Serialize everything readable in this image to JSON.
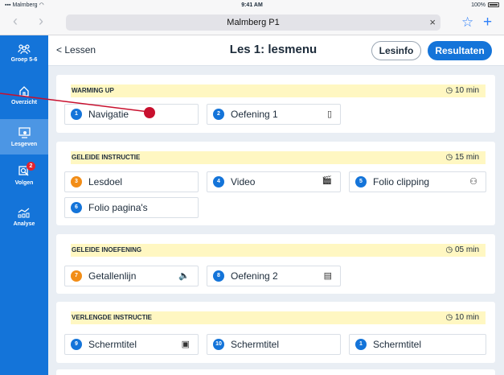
{
  "status": {
    "carrier": "Malmberg",
    "time": "9:41 AM",
    "battery": "100%"
  },
  "browser": {
    "url": "Malmberg P1",
    "clear": "×",
    "back_icon": "chevron-left-icon",
    "forward_icon": "chevron-right-icon",
    "bookmark_icon": "star-icon",
    "add_icon": "plus-icon"
  },
  "sidebar": {
    "items": [
      {
        "label": "Groep 5-6",
        "icon": "group-icon"
      },
      {
        "label": "Overzicht",
        "icon": "home-icon"
      },
      {
        "label": "Lesgeven",
        "icon": "teach-icon"
      },
      {
        "label": "Volgen",
        "icon": "search-person-icon",
        "badge": "2"
      },
      {
        "label": "Analyse",
        "icon": "chart-icon"
      }
    ]
  },
  "header": {
    "back": "< Lessen",
    "title": "Les 1: lesmenu",
    "lesinfo": "Lesinfo",
    "resultaten": "Resultaten"
  },
  "sections": [
    {
      "title": "WARMING UP",
      "time": "10 min",
      "items": [
        {
          "num": "1",
          "label": "Navigatie",
          "icon": ""
        },
        {
          "num": "2",
          "label": "Oefening 1",
          "icon": "tablet-icon"
        }
      ]
    },
    {
      "title": "GELEIDE INSTRUCTIE",
      "time": "15 min",
      "items": [
        {
          "num": "3",
          "label": "Lesdoel",
          "icon": ""
        },
        {
          "num": "4",
          "label": "Video",
          "icon": "clapperboard-icon"
        },
        {
          "num": "5",
          "label": "Folio clipping",
          "icon": "people-icon"
        },
        {
          "num": "6",
          "label": "Folio pagina's",
          "icon": ""
        }
      ]
    },
    {
      "title": "GELEIDE INOEFENING",
      "time": "05 min",
      "items": [
        {
          "num": "7",
          "label": "Getallenlijn",
          "icon": "speaker-icon"
        },
        {
          "num": "8",
          "label": "Oefening 2",
          "icon": "document-icon"
        }
      ]
    },
    {
      "title": "VERLENGDE INSTRUCTIE",
      "time": "10 min",
      "items": [
        {
          "num": "9",
          "label": "Schermtitel",
          "icon": "briefcase-icon"
        },
        {
          "num": "10",
          "label": "Schermtitel",
          "icon": ""
        },
        {
          "num": "1",
          "label": "Schermtitel",
          "icon": ""
        }
      ]
    }
  ],
  "colors": {
    "primary": "#1474d9",
    "accent_orange": "#f28d17",
    "highlight": "#fff7c2",
    "annotation": "#c8102e"
  }
}
